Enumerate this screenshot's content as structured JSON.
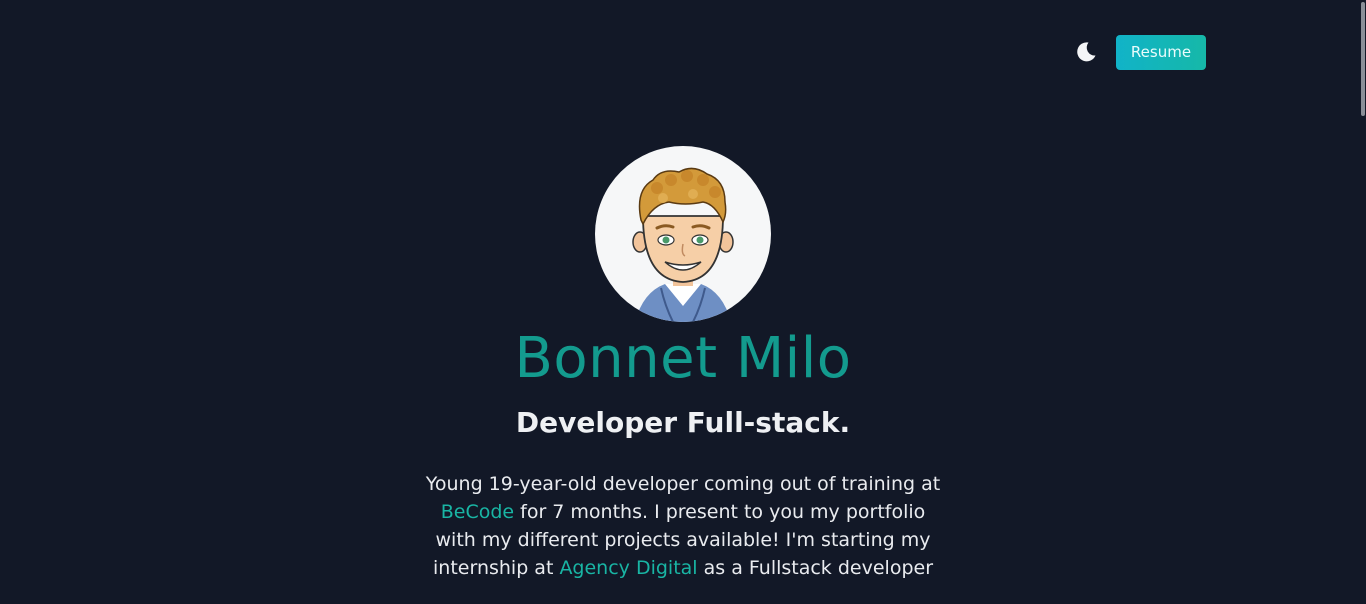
{
  "header": {
    "theme_toggle_icon": "moon-icon",
    "resume_label": "Resume"
  },
  "profile": {
    "avatar_icon": "cartoon-avatar",
    "name": "Bonnet Milo",
    "title": "Developer Full-stack.",
    "bio": {
      "part1": "Young 19-year-old developer coming out of training at ",
      "link1": "BeCode",
      "part2": " for 7 months. I present to you my portfolio with my different projects available! I'm starting my internship at ",
      "link2": "Agency Digital",
      "part3": " as a Fullstack developer"
    }
  },
  "colors": {
    "background": "#121827",
    "accent": "#139b8e",
    "button": "#11b3c8"
  }
}
